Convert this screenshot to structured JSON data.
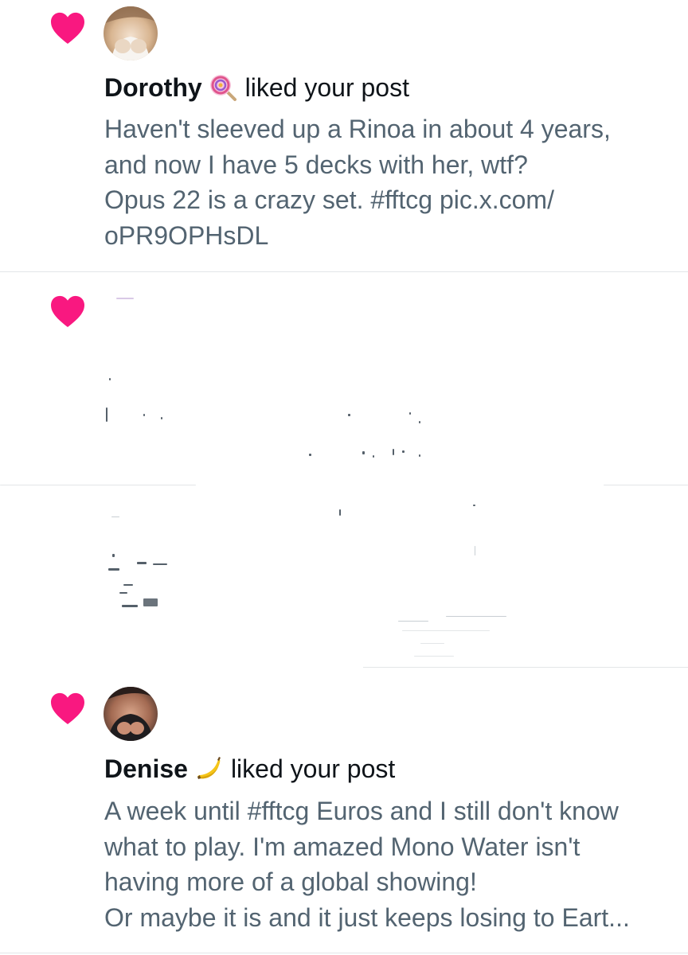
{
  "notifications": [
    {
      "user_name": "Dorothy",
      "user_emoji": "lollipop-icon",
      "action": "liked your post",
      "post_text": "Haven't sleeved up a Rinoa in about 4 years,\nand now I have 5 decks with her, wtf?\nOpus 22 is a crazy set. #fftcg pic.x.com/\noPR9OPHsDL"
    },
    {
      "user_name": "Denise",
      "user_emoji": "banana-icon",
      "action": "liked your post",
      "post_text": "A week until #fftcg Euros and I still don't know\nwhat to play. I'm amazed Mono Water isn't\nhaving more of a global showing!\nOr maybe it is and it just keeps losing to Eart..."
    }
  ],
  "colors": {
    "heart": "#f91880",
    "name_text": "#0f1419",
    "post_text": "#536471",
    "divider": "#e3e6e8"
  }
}
